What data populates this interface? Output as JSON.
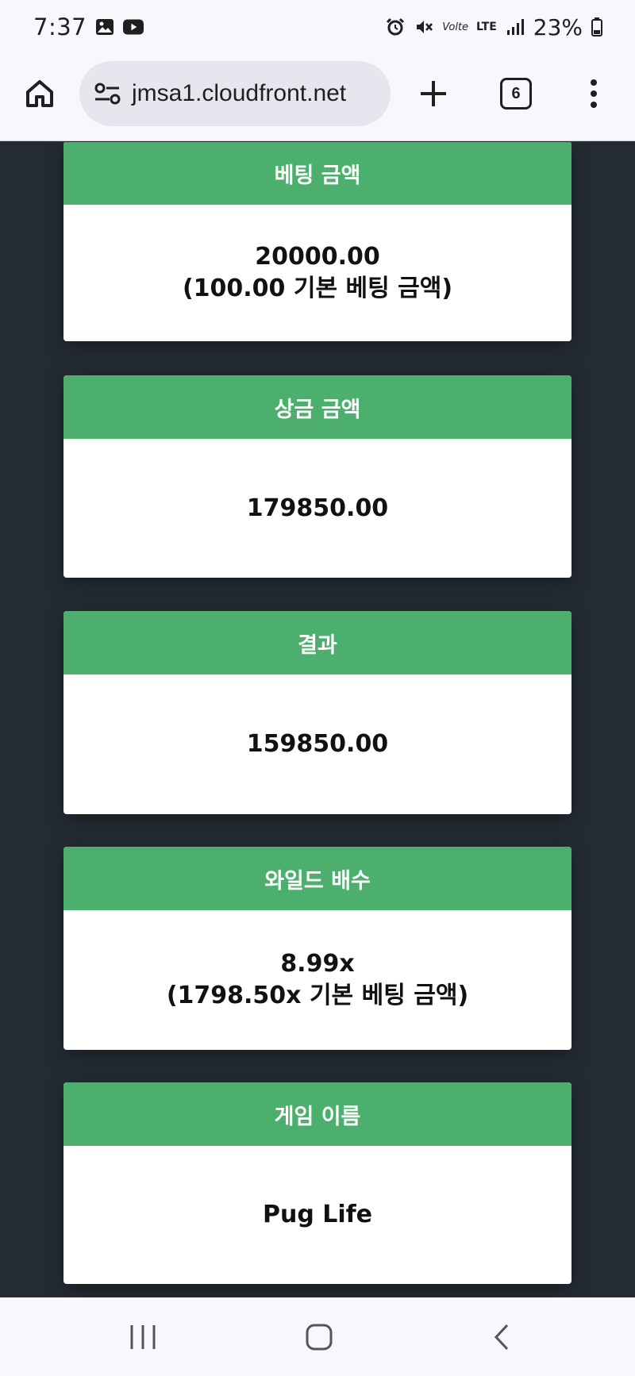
{
  "status_bar": {
    "time": "7:37",
    "battery": "23%",
    "network": "LTE",
    "volte": "Volte"
  },
  "browser": {
    "url": "jmsa1.cloudfront.net",
    "tab_count": "6"
  },
  "cards": [
    {
      "title": "베팅 금액",
      "line1": "20000.00",
      "line2": "(100.00 기본 베팅 금액)"
    },
    {
      "title": "상금 금액",
      "line1": "179850.00",
      "line2": ""
    },
    {
      "title": "결과",
      "line1": "159850.00",
      "line2": ""
    },
    {
      "title": "와일드 배수",
      "line1": "8.99x",
      "line2": "(1798.50x 기본 베팅 금액)"
    },
    {
      "title": "게임 이름",
      "line1": "Pug Life",
      "line2": ""
    }
  ],
  "colors": {
    "card_header": "#4caf6e",
    "page_background": "#242b33",
    "card_background": "#ffffff"
  }
}
